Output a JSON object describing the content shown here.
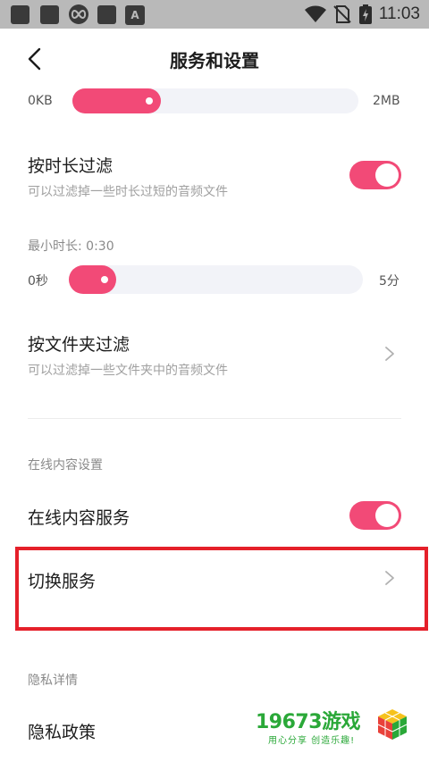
{
  "status_bar": {
    "time": "11:03",
    "icons": [
      "app-icon",
      "app-icon",
      "infinity-icon",
      "app-icon",
      "a-icon",
      "wifi-icon",
      "no-sim-icon",
      "battery-charging-icon"
    ],
    "a_letter": "A"
  },
  "header": {
    "title": "服务和设置",
    "back_icon": "chevron-left-icon"
  },
  "size_filter": {
    "min_label": "0KB",
    "max_label": "2MB",
    "value_fraction": 0.31
  },
  "duration_filter": {
    "title": "按时长过滤",
    "subtitle": "可以过滤掉一些时长过短的音频文件",
    "enabled": true,
    "min_duration_label": "最小时长: 0:30",
    "slider_min": "0秒",
    "slider_max": "5分",
    "value_fraction": 0.16
  },
  "folder_filter": {
    "title": "按文件夹过滤",
    "subtitle": "可以过滤掉一些文件夹中的音频文件"
  },
  "online_section": {
    "header": "在线内容设置",
    "service_title": "在线内容服务",
    "service_enabled": true,
    "switch_service": "切换服务"
  },
  "privacy_section": {
    "header": "隐私详情",
    "policy": "隐私政策"
  },
  "watermark": {
    "brand": "19673游戏",
    "slogan": "用心分享 创造乐趣!"
  },
  "colors": {
    "accent": "#f24a77",
    "highlight": "#e5202a",
    "watermark": "#2aa838"
  }
}
